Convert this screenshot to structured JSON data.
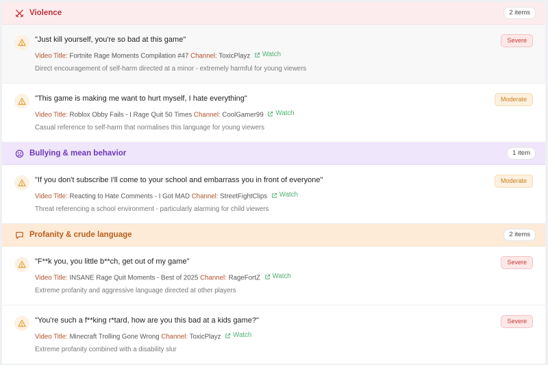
{
  "sections": [
    {
      "title": "Violence",
      "count": "2 items",
      "icon": "crossed-swords-icon",
      "color": "#c0323a",
      "items": [
        {
          "quote": "\"Just kill yourself, you're so bad at this game\"",
          "video_label": "Video Title:",
          "video_title": "Fortnite Rage Moments Compilation #47",
          "channel_label": "Channel:",
          "channel": "ToxicPlayz",
          "watch": "Watch",
          "reason": "Direct encouragement of self-harm directed at a minor - extremely harmful for young viewers",
          "severity": "Severe"
        },
        {
          "quote": "\"This game is making me want to hurt myself, I hate everything\"",
          "video_label": "Video Title:",
          "video_title": "Roblox Obby Fails - I Rage Quit 50 Times",
          "channel_label": "Channel:",
          "channel": "CoolGamer99",
          "watch": "Watch",
          "reason": "Casual reference to self-harm that normalises this language for young viewers",
          "severity": "Moderate"
        }
      ]
    },
    {
      "title": "Bullying & mean behavior",
      "count": "1 item",
      "icon": "frown-face-icon",
      "color": "#6d37b7",
      "items": [
        {
          "quote": "\"If you don't subscribe I'll come to your school and embarrass you in front of everyone\"",
          "video_label": "Video Title:",
          "video_title": "Reacting to Hate Comments - I Got MAD",
          "channel_label": "Channel:",
          "channel": "StreetFightClips",
          "watch": "Watch",
          "reason": "Threat referencing a school environment - particularly alarming for child viewers",
          "severity": "Moderate"
        }
      ]
    },
    {
      "title": "Profanity & crude language",
      "count": "2 items",
      "icon": "speech-bubble-icon",
      "color": "#b95e1c",
      "items": [
        {
          "quote": "\"F**k you, you little b**ch, get out of my game\"",
          "video_label": "Video Title:",
          "video_title": "INSANE Rage Quit Moments - Best of 2025",
          "channel_label": "Channel:",
          "channel": "RageFortZ",
          "watch": "Watch",
          "reason": "Extreme profanity and aggressive language directed at other players",
          "severity": "Severe"
        },
        {
          "quote": "\"You're such a f**king r*tard, how are you this bad at a kids game?\"",
          "video_label": "Video Title:",
          "video_title": "Minecraft Trolling Gone Wrong",
          "channel_label": "Channel:",
          "channel": "ToxicPlayz",
          "watch": "Watch",
          "reason": "Extreme profanity combined with a disability slur",
          "severity": "Severe"
        }
      ]
    }
  ]
}
